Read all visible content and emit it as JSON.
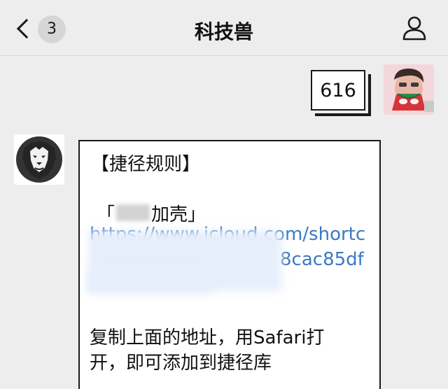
{
  "header": {
    "title": "科技兽",
    "unread_count": "3",
    "back_icon": "chevron-left-icon",
    "profile_icon": "person-outline-icon"
  },
  "messages": {
    "sent": {
      "text": "616"
    },
    "received": {
      "heading": "【捷径规则】",
      "shortcut_open": "「",
      "shortcut_name_visible": "加壳」",
      "link_line1_visible": "https://www.icloud.com/shortc",
      "link_line2_visible": "8cac85df",
      "instruction_line1": "复制上面的地址，用Safari打",
      "instruction_line2": "开，即可添加到捷径库"
    }
  },
  "colors": {
    "background": "#ededed",
    "bubble": "#ffffff",
    "link": "#3b79c4",
    "text": "#111111"
  }
}
